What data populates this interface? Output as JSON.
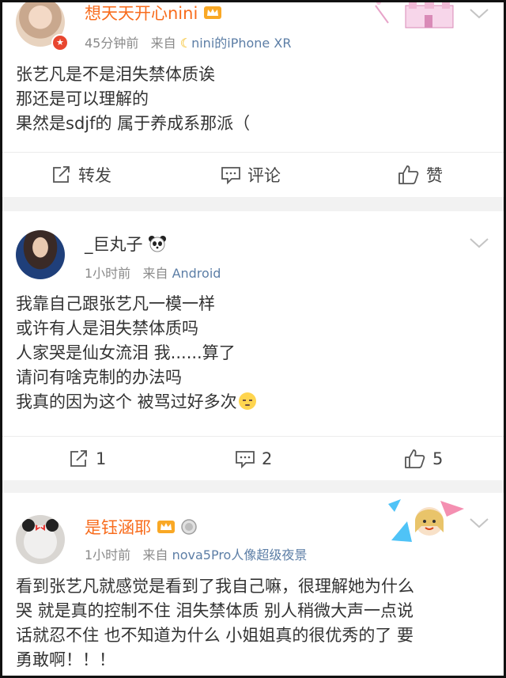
{
  "posts": [
    {
      "username": "想天天开心nini",
      "time": "45分钟前",
      "from_label": "来自",
      "source": "nini的iPhone XR",
      "lines": [
        "张艺凡是不是泪失禁体质诶",
        "那还是可以理解的",
        "果然是sdjf的 属于养成系那派（"
      ],
      "actions": {
        "repost": "转发",
        "comment": "评论",
        "like": "赞"
      }
    },
    {
      "username": "_巨丸子",
      "time": "1小时前",
      "from_label": "来自",
      "source": "Android",
      "lines": [
        "我靠自己跟张艺凡一模一样",
        "或许有人是泪失禁体质吗",
        "人家哭是仙女流泪 我......算了",
        "请问有啥克制的办法吗",
        "我真的因为这个 被骂过好多次"
      ],
      "actions": {
        "repost": "1",
        "comment": "2",
        "like": "5"
      }
    },
    {
      "username": "是钰涵耶",
      "time": "1小时前",
      "from_label": "来自",
      "source": "nova5Pro人像超级夜景",
      "lines": [
        "看到张艺凡就感觉是看到了我自己嘛，很理解她为什么",
        "哭 就是真的控制不住 泪失禁体质 别人稍微大声一点说",
        "话就忍不住 也不知道为什么 小姐姐真的很优秀的了 要",
        "勇敢啊！！！"
      ]
    }
  ],
  "colors": {
    "vip_name": "#f86c1d",
    "source_link": "#5c7ea6",
    "separator": "#f2f2f2"
  }
}
